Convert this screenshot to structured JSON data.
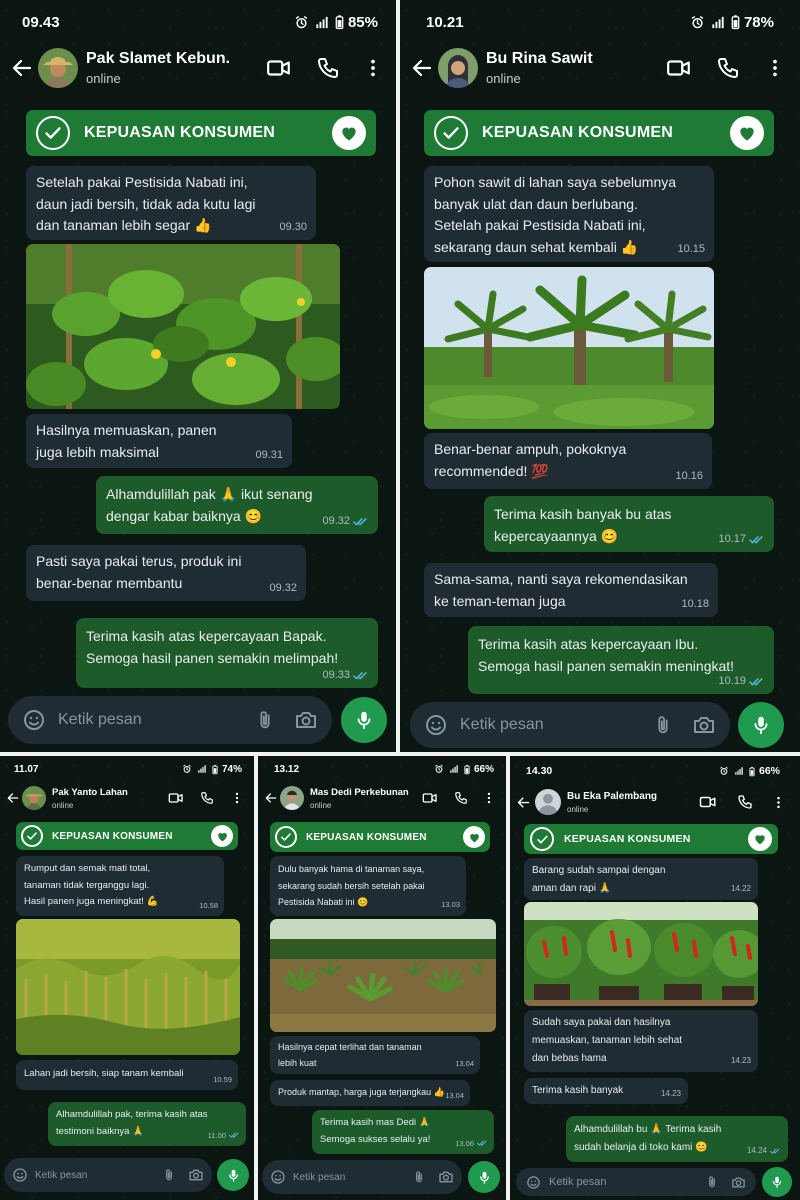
{
  "banner_text": "KEPUASAN KONSUMEN",
  "placeholder": "Ketik pesan",
  "status_online": "online",
  "battery_icon": "battery-icon",
  "colors": {
    "banner": "#1f7a36",
    "incoming": "#202c33",
    "outgoing": "#1e5b2b",
    "mic": "#1f9a4e",
    "ticks": "#53bdeb"
  },
  "p1": {
    "time": "09.43",
    "battery": "85%",
    "name": "Pak Slamet Kebun.",
    "m1": {
      "l1": "Setelah pakai Pestisida Nabati ini,",
      "l2": "daun jadi bersih, tidak ada kutu lagi",
      "l3": "dan tanaman lebih segar 👍",
      "t": "09.30"
    },
    "m2": {
      "l1": "Hasilnya memuaskan, panen",
      "l2": "juga lebih maksimal",
      "t": "09.31"
    },
    "m3": {
      "l1": "Alhamdulillah pak 🙏 ikut senang",
      "l2": "dengar kabar baiknya 😊",
      "t": "09.32"
    },
    "m4": {
      "l1": "Pasti saya pakai terus, produk ini",
      "l2": "benar-benar membantu",
      "t": "09.32"
    },
    "m5": {
      "l1": "Terima kasih atas kepercayaan Bapak.",
      "l2": "Semoga hasil panen semakin melimpah!",
      "t": "09.33"
    }
  },
  "p2": {
    "time": "10.21",
    "battery": "78%",
    "name": "Bu Rina Sawit",
    "m1": {
      "l1": "Pohon sawit di lahan saya sebelumnya",
      "l2": "banyak ulat dan daun berlubang.",
      "l3": "Setelah pakai Pestisida Nabati ini,",
      "l4": "sekarang daun sehat kembali 👍",
      "t": "10.15"
    },
    "m2": {
      "l1": "Benar-benar ampuh, pokoknya",
      "l2": "recommended! 💯",
      "t": "10.16"
    },
    "m3": {
      "l1": "Terima kasih banyak bu atas",
      "l2": "kepercayaannya 😊",
      "t": "10.17"
    },
    "m4": {
      "l1": "Sama-sama, nanti saya rekomendasikan",
      "l2": "ke teman-teman juga",
      "t": "10.18"
    },
    "m5": {
      "l1": "Terima kasih atas kepercayaan Ibu.",
      "l2": "Semoga hasil panen semakin meningkat!",
      "t": "10.19"
    }
  },
  "p3": {
    "time": "11.07",
    "battery": "74%",
    "name": "Pak Yanto Lahan",
    "m1": {
      "l1": "Rumput dan semak mati total,",
      "l2": "tanaman tidak terganggu lagi.",
      "l3": "Hasil panen juga meningkat! 💪",
      "t": "10.58"
    },
    "m2": {
      "l1": "Lahan jadi bersih, siap tanam kembali",
      "t": "10.59"
    },
    "m3": {
      "l1": "Alhamdulillah pak, terima kasih atas",
      "l2": "testimoni baiknya 🙏",
      "t": "11.00"
    }
  },
  "p4": {
    "time": "13.12",
    "battery": "66%",
    "name": "Mas Dedi Perkebunan",
    "m1": {
      "l1": "Dulu banyak hama di tanaman saya,",
      "l2": "sekarang sudah bersih setelah pakai",
      "l3": "Pestisida Nabati ini 😊",
      "t": "13.03"
    },
    "m2": {
      "l1": "Hasilnya cepat terlihat dan tanaman",
      "l2": "lebih kuat",
      "t": "13.04"
    },
    "m3": {
      "l1": "Produk mantap, harga juga terjangkau 👍",
      "t": "13.04"
    },
    "m4": {
      "l1": "Terima kasih mas Dedi 🙏",
      "l2": "Semoga sukses selalu ya!",
      "t": "13.06"
    }
  },
  "p5": {
    "time": "14.30",
    "battery": "66%",
    "name": "Bu Eka Palembang",
    "m1": {
      "l1": "Barang sudah sampai dengan",
      "l2": "aman dan rapi 🙏",
      "t": "14.22"
    },
    "m2": {
      "l1": "Sudah saya pakai dan hasilnya",
      "l2": "memuaskan, tanaman lebih sehat",
      "l3": "dan bebas hama",
      "t": "14.23"
    },
    "m3": {
      "l1": "Terima kasih banyak",
      "t": "14.23"
    },
    "m4": {
      "l1": "Alhamdulillah bu 🙏 Terima kasih",
      "l2": "sudah belanja di toko kami 😊",
      "t": "14.24"
    }
  }
}
